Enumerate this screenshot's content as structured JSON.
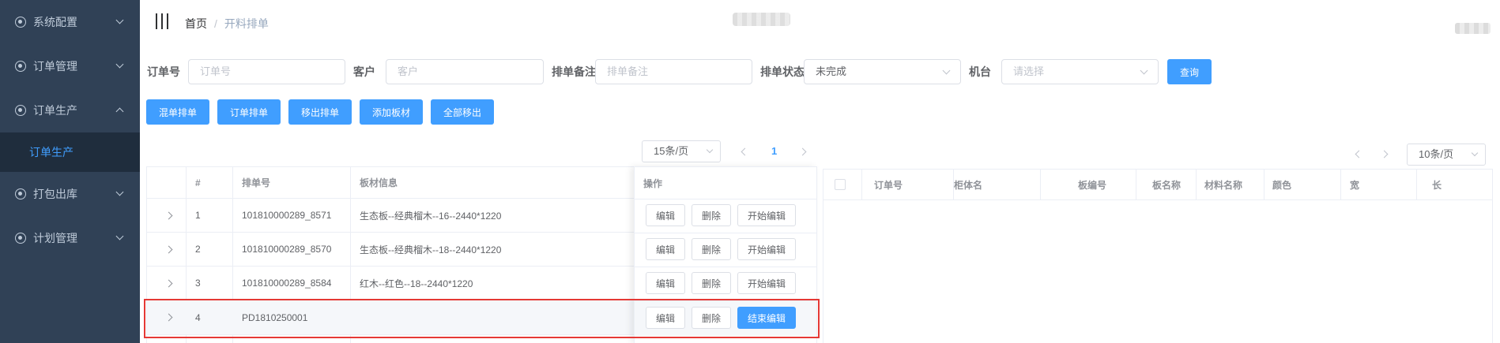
{
  "sidebar": {
    "items": [
      {
        "label": "系统配置"
      },
      {
        "label": "订单管理"
      },
      {
        "label": "订单生产"
      },
      {
        "label": "打包出库"
      },
      {
        "label": "计划管理"
      }
    ],
    "active_sub": "订单生产"
  },
  "header": {
    "breadcrumb_home": "首页",
    "breadcrumb_sep": "/",
    "breadcrumb_current": "开料排单"
  },
  "filters": {
    "order_no_label": "订单号",
    "order_no_placeholder": "订单号",
    "customer_label": "客户",
    "customer_placeholder": "客户",
    "note_label": "排单备注",
    "note_placeholder": "排单备注",
    "status_label": "排单状态",
    "status_value": "未完成",
    "machine_label": "机台",
    "machine_placeholder": "请选择",
    "query_button": "查询"
  },
  "toolbar": {
    "mixed_schedule": "混单排单",
    "order_schedule": "订单排单",
    "remove_schedule": "移出排单",
    "add_board": "添加板材",
    "remove_all": "全部移出"
  },
  "left_pager": {
    "page_size": "15条/页",
    "current_page": "1"
  },
  "right_pager": {
    "page_size": "10条/页"
  },
  "left_table": {
    "headers": {
      "index": "#",
      "schedule_no": "排单号",
      "board_info": "板材信息",
      "actions": "操作"
    },
    "rows": [
      {
        "index": "1",
        "schedule_no": "101810000289_8571",
        "board_info": "生态板--经典榴木--16--2440*1220",
        "edit": "编辑",
        "delete": "删除",
        "toggle": "开始编辑"
      },
      {
        "index": "2",
        "schedule_no": "101810000289_8570",
        "board_info": "生态板--经典榴木--18--2440*1220",
        "edit": "编辑",
        "delete": "删除",
        "toggle": "开始编辑"
      },
      {
        "index": "3",
        "schedule_no": "101810000289_8584",
        "board_info": "红木--红色--18--2440*1220",
        "edit": "编辑",
        "delete": "删除",
        "toggle": "开始编辑"
      },
      {
        "index": "4",
        "schedule_no": "PD1810250001",
        "board_info": "",
        "edit": "编辑",
        "delete": "删除",
        "toggle": "结束编辑"
      }
    ]
  },
  "right_table": {
    "headers": [
      "订单号",
      "柜体名",
      "板编号",
      "板名称",
      "材料名称",
      "颜色",
      "宽",
      "长"
    ]
  },
  "colors": {
    "primary": "#409eff",
    "sidebar": "#304156",
    "highlight": "#e53935"
  }
}
